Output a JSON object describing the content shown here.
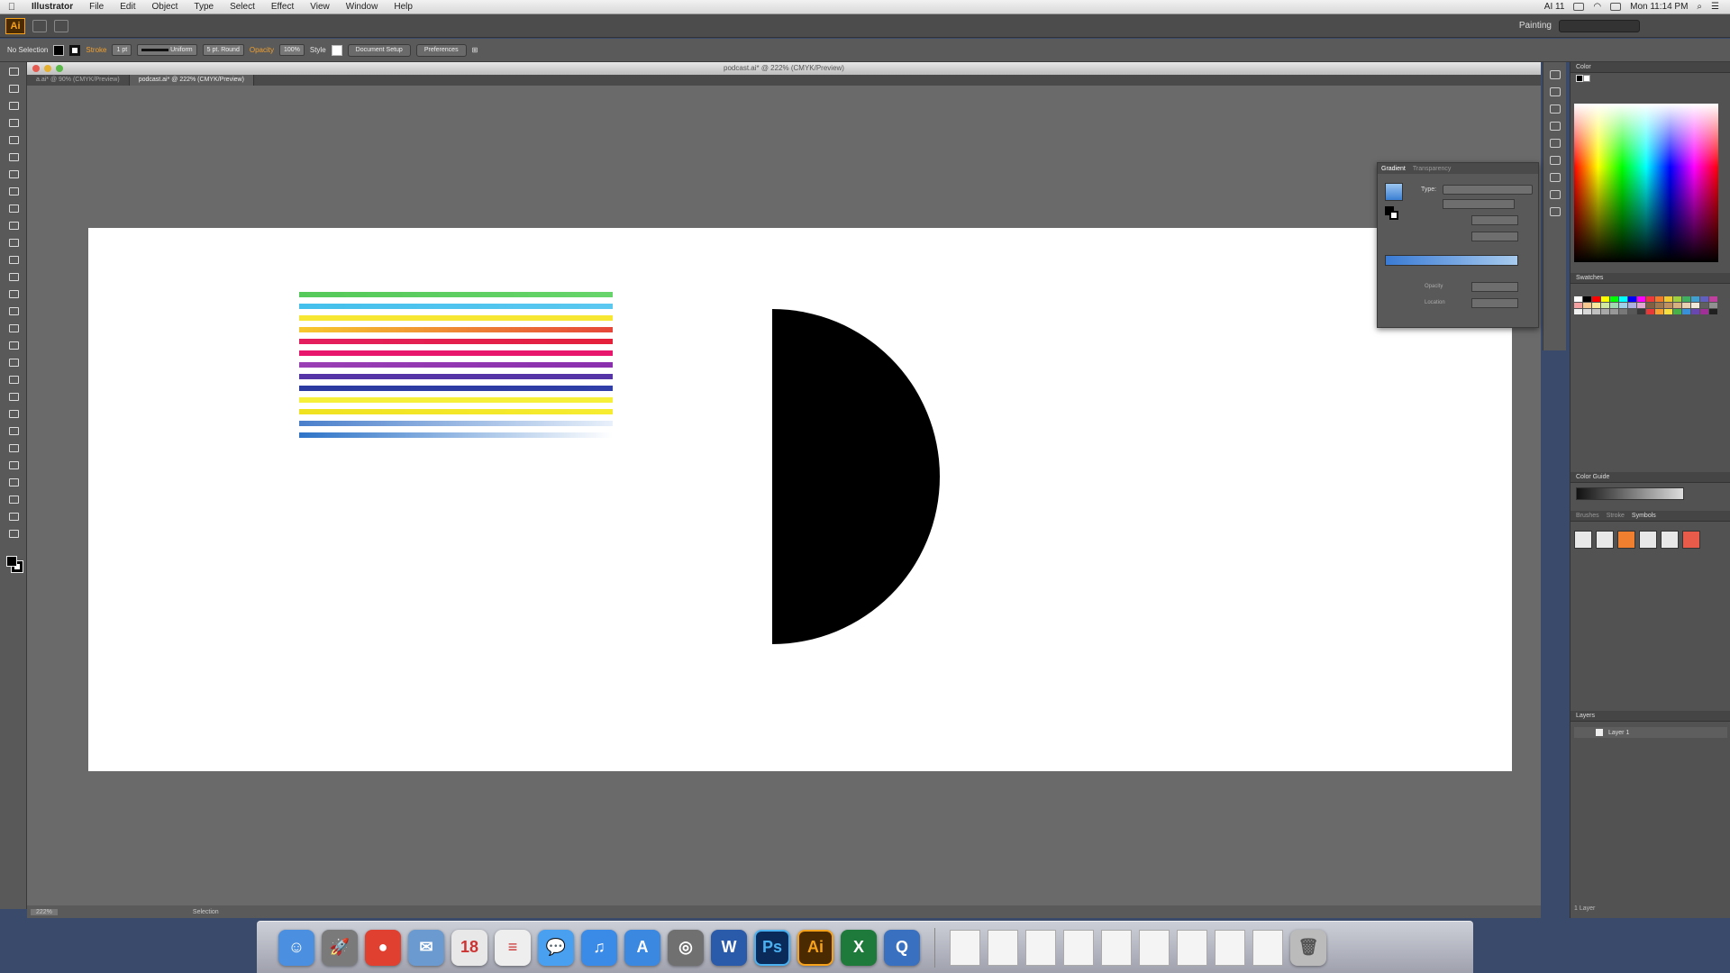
{
  "menubar": {
    "app_name": "Illustrator",
    "items": [
      "File",
      "Edit",
      "Object",
      "Type",
      "Select",
      "Effect",
      "View",
      "Window",
      "Help"
    ],
    "clock": "Mon 11:14 PM",
    "battery_label": "AI 11"
  },
  "appbar": {
    "logo": "Ai",
    "workspace": "Painting"
  },
  "controlbar": {
    "selection": "No Selection",
    "stroke_label": "Stroke",
    "stroke_weight": "1 pt",
    "profile": "Uniform",
    "brush": "5 pt. Round",
    "opacity_label": "Opacity",
    "opacity_value": "100%",
    "style_label": "Style",
    "doc_setup": "Document Setup",
    "preferences": "Preferences"
  },
  "document": {
    "title": "podcast.ai* @ 222% (CMYK/Preview)",
    "tabs": [
      "a.ai* @ 90% (CMYK/Preview)",
      "podcast.ai* @ 222% (CMYK/Preview)"
    ],
    "status_zoom": "222%",
    "status_tool": "Selection"
  },
  "stripes": [
    [
      "#55c95a",
      "#66d46a"
    ],
    [
      "#44c0ec",
      "#5bc8f0"
    ],
    [
      "#f7e733",
      "#f7e733"
    ],
    [
      "#f7c92e",
      "#e6463a"
    ],
    [
      "#e41e5f",
      "#e4203b"
    ],
    [
      "#e8166d",
      "#e8166d"
    ],
    [
      "#9b3fb5",
      "#8a2fae"
    ],
    [
      "#5434a6",
      "#5434a6"
    ],
    [
      "#2a3aa0",
      "#2f3ea8"
    ],
    [
      "#f7f03a",
      "#f7f03a"
    ],
    [
      "#f0e21f",
      "#f7ec30"
    ],
    [
      "#4a7fcb",
      "#e8f0fa"
    ],
    [
      "#2e74c8",
      "#ffffff"
    ]
  ],
  "gradient_panel": {
    "tabs": [
      "Gradient",
      "Transparency"
    ],
    "type_label": "Type:",
    "location_label": "Location",
    "opacity_label": "Opacity"
  },
  "right_panels": {
    "color": "Color",
    "swatches": "Swatches",
    "color_guide": "Color Guide",
    "brushes": "Brushes",
    "stroke": "Stroke",
    "symbols": "Symbols",
    "layers": "Layers",
    "layer_name": "Layer 1",
    "layers_count": "1 Layer"
  },
  "swatch_colors": [
    "#ffffff",
    "#000000",
    "#ff0000",
    "#ffff00",
    "#00ff00",
    "#00ffff",
    "#0000ff",
    "#ff00ff",
    "#ee3a3a",
    "#f07a2a",
    "#f0c830",
    "#a0d040",
    "#40b060",
    "#40a0d0",
    "#6060c0",
    "#c040a0",
    "#f4a0a0",
    "#f8c890",
    "#f8e898",
    "#d0e8a0",
    "#a0d8b0",
    "#a0d0e8",
    "#b0b0e0",
    "#e0a8d0",
    "#806040",
    "#a07850",
    "#c09060",
    "#d8b080",
    "#e8d0b0",
    "#f0e8d8",
    "#606060",
    "#909090",
    "#f0f0f0",
    "#d8d8d8",
    "#c0c0c0",
    "#a8a8a8",
    "#989898",
    "#787878",
    "#585858",
    "#383838",
    "#e83838",
    "#f8a030",
    "#f8e040",
    "#48b048",
    "#3890d8",
    "#6848b0",
    "#a03098",
    "#202020"
  ],
  "dock": {
    "apps": [
      {
        "label": "Finder",
        "color": "#4a8fe0",
        "glyph": "☺"
      },
      {
        "label": "Launchpad",
        "color": "#7a7a7a",
        "glyph": "🚀"
      },
      {
        "label": "Chrome",
        "color": "#e04030",
        "glyph": "●"
      },
      {
        "label": "Mail",
        "color": "#6a9ad0",
        "glyph": "✉"
      },
      {
        "label": "Calendar",
        "color": "#e8e8e8",
        "glyph": "18"
      },
      {
        "label": "Notes",
        "color": "#eeeeee",
        "glyph": "≡"
      },
      {
        "label": "Messages",
        "color": "#4aa0f0",
        "glyph": "💬"
      },
      {
        "label": "iTunes",
        "color": "#3a8ae8",
        "glyph": "♫"
      },
      {
        "label": "App Store",
        "color": "#3a88e0",
        "glyph": "A"
      },
      {
        "label": "Photo Booth",
        "color": "#707070",
        "glyph": "◎"
      },
      {
        "label": "Word",
        "color": "#2a5aaa",
        "glyph": "W"
      },
      {
        "label": "Photoshop",
        "color": "#0a2a5a",
        "glyph": "Ps"
      },
      {
        "label": "Illustrator",
        "color": "#4a2a00",
        "glyph": "Ai"
      },
      {
        "label": "Excel",
        "color": "#1e7a3a",
        "glyph": "X"
      },
      {
        "label": "QuickTime",
        "color": "#3a70c0",
        "glyph": "Q"
      }
    ]
  }
}
